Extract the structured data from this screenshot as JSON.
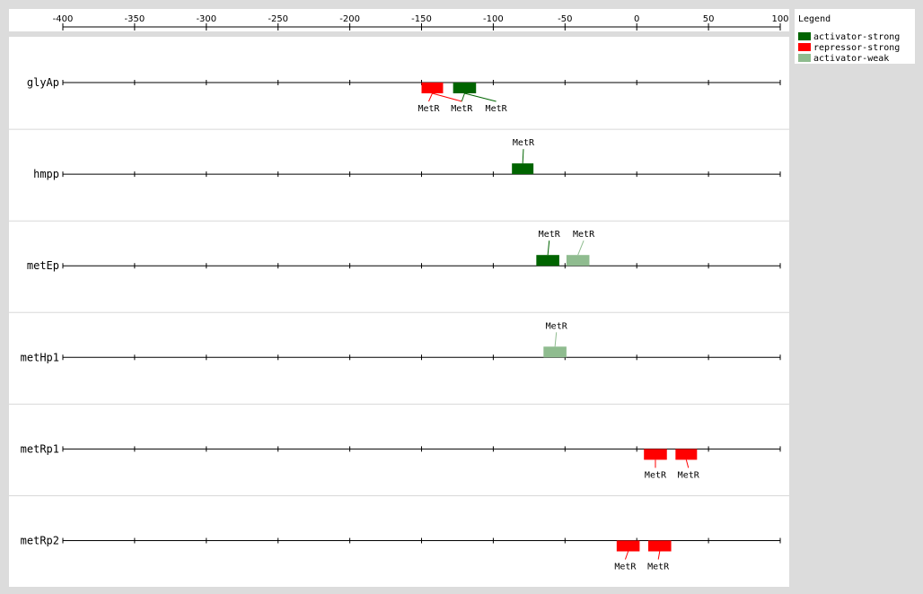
{
  "axis": {
    "min": -400,
    "max": 100,
    "ticks": [
      -400,
      -350,
      -300,
      -250,
      -200,
      -150,
      -100,
      -50,
      0,
      50,
      100
    ],
    "tick_labels": [
      "-400",
      "-350",
      "-300",
      "-250",
      "-200",
      "-150",
      "-100",
      "-50",
      "0",
      "50",
      "100"
    ]
  },
  "legend": {
    "title": "Legend",
    "items": [
      {
        "key": "activator-strong",
        "label": "activator-strong",
        "color": "#006400"
      },
      {
        "key": "repressor-strong",
        "label": "repressor-strong",
        "color": "#ff0000"
      },
      {
        "key": "activator-weak",
        "label": "activator-weak",
        "color": "#8fbc8f"
      }
    ]
  },
  "promoters": [
    {
      "name": "glyAp",
      "sites": [
        {
          "label": "MetR",
          "start": -150,
          "end": -135,
          "type": "repressor-strong",
          "side": "below",
          "label_pos": -145
        },
        {
          "label": "MetR",
          "start": -128,
          "end": -112,
          "type": "activator-strong",
          "side": "below",
          "label_pos": -122
        },
        {
          "label": "MetR",
          "start": -128,
          "end": -112,
          "type": "activator-strong",
          "side": "below",
          "label_pos": -98,
          "hidden_box": true
        },
        {
          "label": "MetR",
          "start": -150,
          "end": -135,
          "type": "repressor-strong",
          "side": "below",
          "label_pos": -122,
          "hidden_box": true,
          "hidden_label": true
        }
      ]
    },
    {
      "name": "hmpp",
      "sites": [
        {
          "label": "MetR",
          "start": -87,
          "end": -72,
          "type": "activator-strong",
          "side": "above",
          "label_pos": -79
        }
      ]
    },
    {
      "name": "metEp",
      "sites": [
        {
          "label": "MetR",
          "start": -70,
          "end": -54,
          "type": "activator-strong",
          "side": "above",
          "label_pos": -61
        },
        {
          "label": "MetR",
          "start": -49,
          "end": -33,
          "type": "activator-weak",
          "side": "above",
          "label_pos": -37
        }
      ]
    },
    {
      "name": "metHp1",
      "sites": [
        {
          "label": "MetR",
          "start": -65,
          "end": -49,
          "type": "activator-weak",
          "side": "above",
          "label_pos": -56
        }
      ]
    },
    {
      "name": "metRp1",
      "sites": [
        {
          "label": "MetR",
          "start": 5,
          "end": 21,
          "type": "repressor-strong",
          "side": "below",
          "label_pos": 13
        },
        {
          "label": "MetR",
          "start": 27,
          "end": 42,
          "type": "repressor-strong",
          "side": "below",
          "label_pos": 36
        }
      ]
    },
    {
      "name": "metRp2",
      "sites": [
        {
          "label": "MetR",
          "start": -14,
          "end": 2,
          "type": "repressor-strong",
          "side": "below",
          "label_pos": -8
        },
        {
          "label": "MetR",
          "start": 8,
          "end": 24,
          "type": "repressor-strong",
          "side": "below",
          "label_pos": 15
        }
      ]
    }
  ]
}
